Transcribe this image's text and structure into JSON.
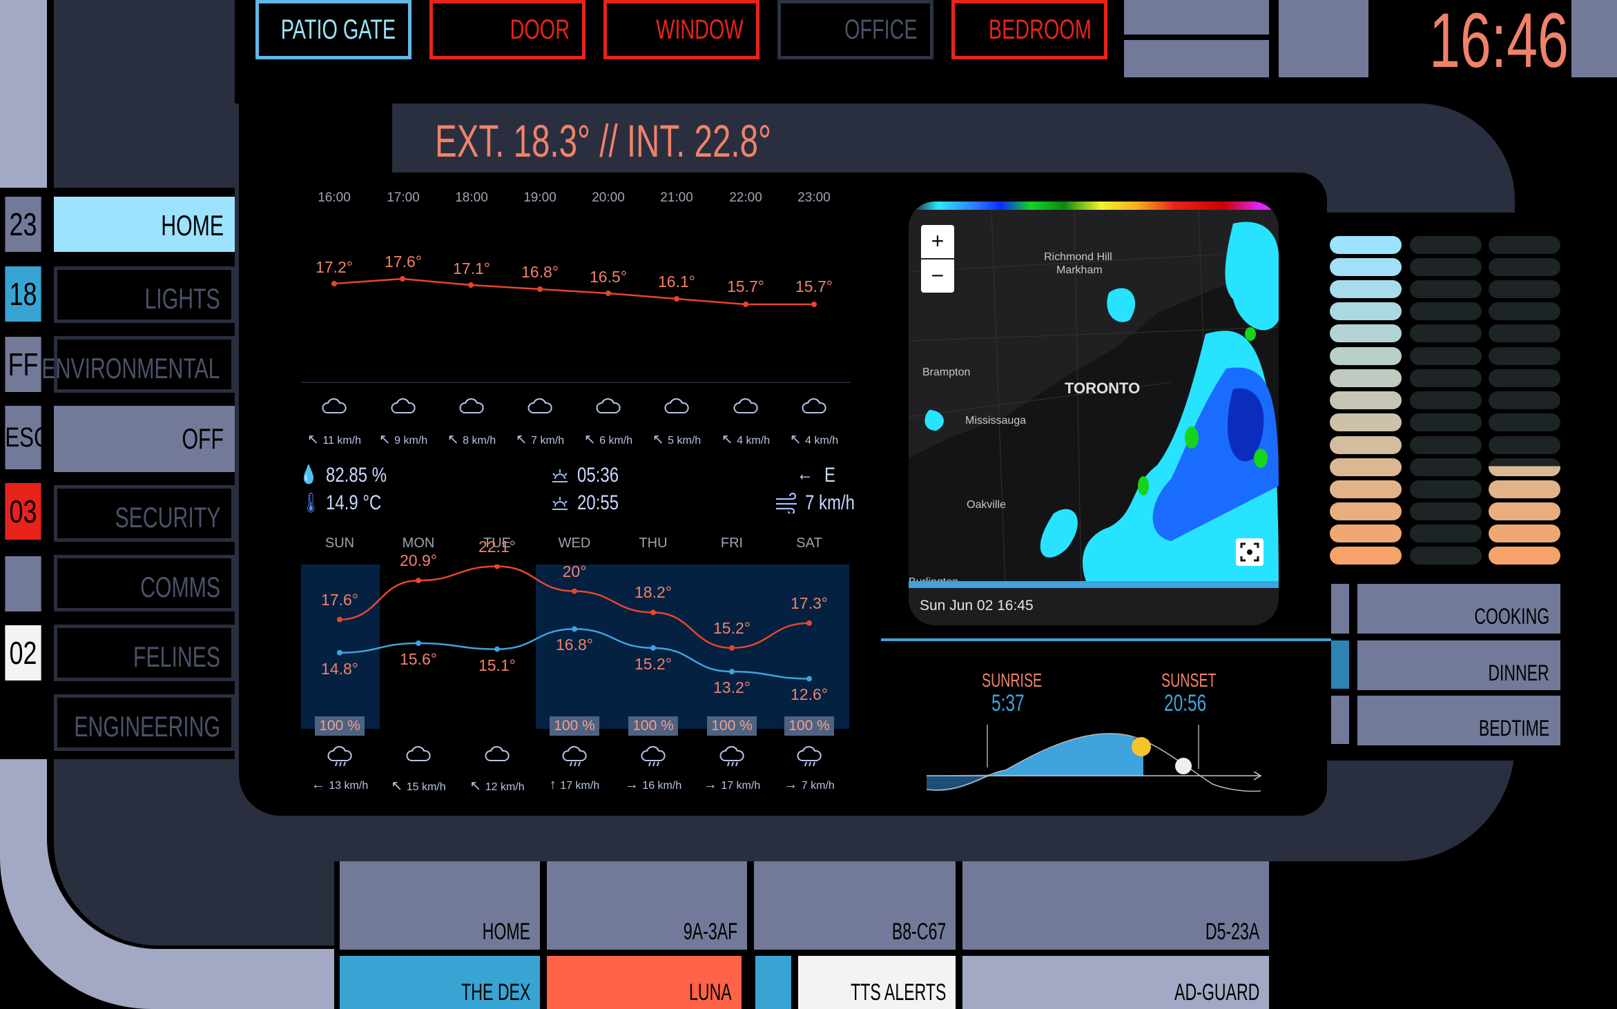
{
  "clock": "16:46",
  "colors": {
    "accent_blue": "#9de3ff",
    "red": "#e8231c",
    "frame": "#737a99",
    "frame_dark": "#2a2f3f",
    "text_orange": "#f0826a"
  },
  "doors": [
    {
      "label": "PATIO GATE",
      "state": "open",
      "color": "#62b8e4"
    },
    {
      "label": "DOOR",
      "state": "closed",
      "color": "#e8231c"
    },
    {
      "label": "WINDOW",
      "state": "closed",
      "color": "#e8231c"
    },
    {
      "label": "OFFICE",
      "state": "inactive",
      "color": "#2d3345"
    },
    {
      "label": "BEDROOM",
      "state": "closed",
      "color": "#e8231c"
    }
  ],
  "headline": "EXT. 18.3° // INT. 22.8°",
  "side_codes": [
    "23",
    "18",
    "FF",
    "ESC",
    "03",
    "",
    "02"
  ],
  "menu": [
    {
      "label": "HOME",
      "active": true
    },
    {
      "label": "LIGHTS",
      "active": false
    },
    {
      "label": "ENVIRONMENTAL",
      "active": false
    },
    {
      "label": "OFF",
      "active": false
    },
    {
      "label": "SECURITY",
      "active": false
    },
    {
      "label": "COMMS",
      "active": false
    },
    {
      "label": "FELINES",
      "active": false
    },
    {
      "label": "ENGINEERING",
      "active": false
    }
  ],
  "hourly": {
    "hours": [
      "16:00",
      "17:00",
      "18:00",
      "19:00",
      "20:00",
      "21:00",
      "22:00",
      "23:00"
    ],
    "temps": [
      "17.2°",
      "17.6°",
      "17.1°",
      "16.8°",
      "16.5°",
      "16.1°",
      "15.7°",
      "15.7°"
    ],
    "temp_values": [
      17.2,
      17.6,
      17.1,
      16.8,
      16.5,
      16.1,
      15.7,
      15.7
    ],
    "icons": [
      "cloud-icon",
      "cloud-icon",
      "cloud-icon",
      "cloud-icon",
      "cloud-icon",
      "cloud-icon",
      "cloud-icon",
      "cloud-icon"
    ],
    "wind": [
      "11 km/h",
      "9 km/h",
      "8 km/h",
      "7 km/h",
      "6 km/h",
      "5 km/h",
      "4 km/h",
      "4 km/h"
    ]
  },
  "current": {
    "humidity": "82.85 %",
    "dewpoint": "14.9 °C",
    "sunrise": "05:36",
    "sunset": "20:55",
    "wind_dir": "E",
    "wind_speed": "7 km/h"
  },
  "daily": {
    "days": [
      "SUN",
      "MON",
      "TUE",
      "WED",
      "THU",
      "FRI",
      "SAT"
    ],
    "highs": [
      "17.6°",
      "20.9°",
      "22.1°",
      "20°",
      "18.2°",
      "15.2°",
      "17.3°"
    ],
    "high_values": [
      17.6,
      20.9,
      22.1,
      20,
      18.2,
      15.2,
      17.3
    ],
    "lows": [
      "14.8°",
      "15.6°",
      "15.1°",
      "16.8°",
      "15.2°",
      "13.2°",
      "12.6°"
    ],
    "low_values": [
      14.8,
      15.6,
      15.1,
      16.8,
      15.2,
      13.2,
      12.6
    ],
    "precip": [
      "100 %",
      "",
      "",
      "100 %",
      "100 %",
      "100 %",
      "100 %"
    ],
    "icons": [
      "rain-cloud-icon",
      "cloud-icon",
      "cloud-icon",
      "rain-cloud-icon",
      "rain-cloud-icon",
      "rain-cloud-icon",
      "rain-cloud-icon"
    ],
    "wind": [
      "13 km/h",
      "15 km/h",
      "12 km/h",
      "17 km/h",
      "16 km/h",
      "17 km/h",
      "7 km/h"
    ],
    "wind_arrows": [
      "←",
      "↖",
      "↖",
      "↑",
      "→",
      "→",
      "→"
    ]
  },
  "radar": {
    "zoom_in": "+",
    "zoom_out": "−",
    "places": [
      "Richmond Hill",
      "Markham",
      "Brampton",
      "TORONTO",
      "Mississauga",
      "Oakville",
      "Burlington"
    ],
    "timestamp": "Sun Jun 02 16:45"
  },
  "sun": {
    "sunrise_label": "SUNRISE",
    "sunrise_time": "5:37",
    "sunset_label": "SUNSET",
    "sunset_time": "20:56"
  },
  "scenes": [
    "COOKING",
    "DINNER",
    "BEDTIME"
  ],
  "bottom": [
    "HOME",
    "9A-3AF",
    "B8-C67",
    "D5-23A"
  ],
  "bottom2": [
    "THE DEX",
    "LUNA",
    "",
    "TTS ALERTS",
    "AD-GUARD"
  ]
}
